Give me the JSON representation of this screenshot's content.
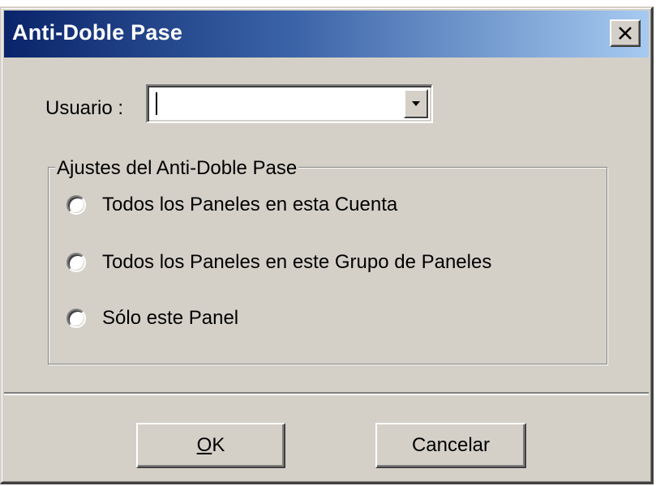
{
  "window": {
    "title": "Anti-Doble Pase",
    "close_icon": "close-icon"
  },
  "user": {
    "label": "Usuario :",
    "value": "",
    "dropdown_icon": "chevron-down-icon"
  },
  "settings": {
    "group_label": "Ajustes del Anti-Doble Pase",
    "options": [
      {
        "label": "Todos los Paneles en esta Cuenta",
        "selected": false
      },
      {
        "label": "Todos los Paneles en este Grupo de Paneles",
        "selected": false
      },
      {
        "label": "Sólo este Panel",
        "selected": false
      }
    ]
  },
  "buttons": {
    "ok_mnemonic": "O",
    "ok_rest": "K",
    "cancel_label": "Cancelar"
  }
}
